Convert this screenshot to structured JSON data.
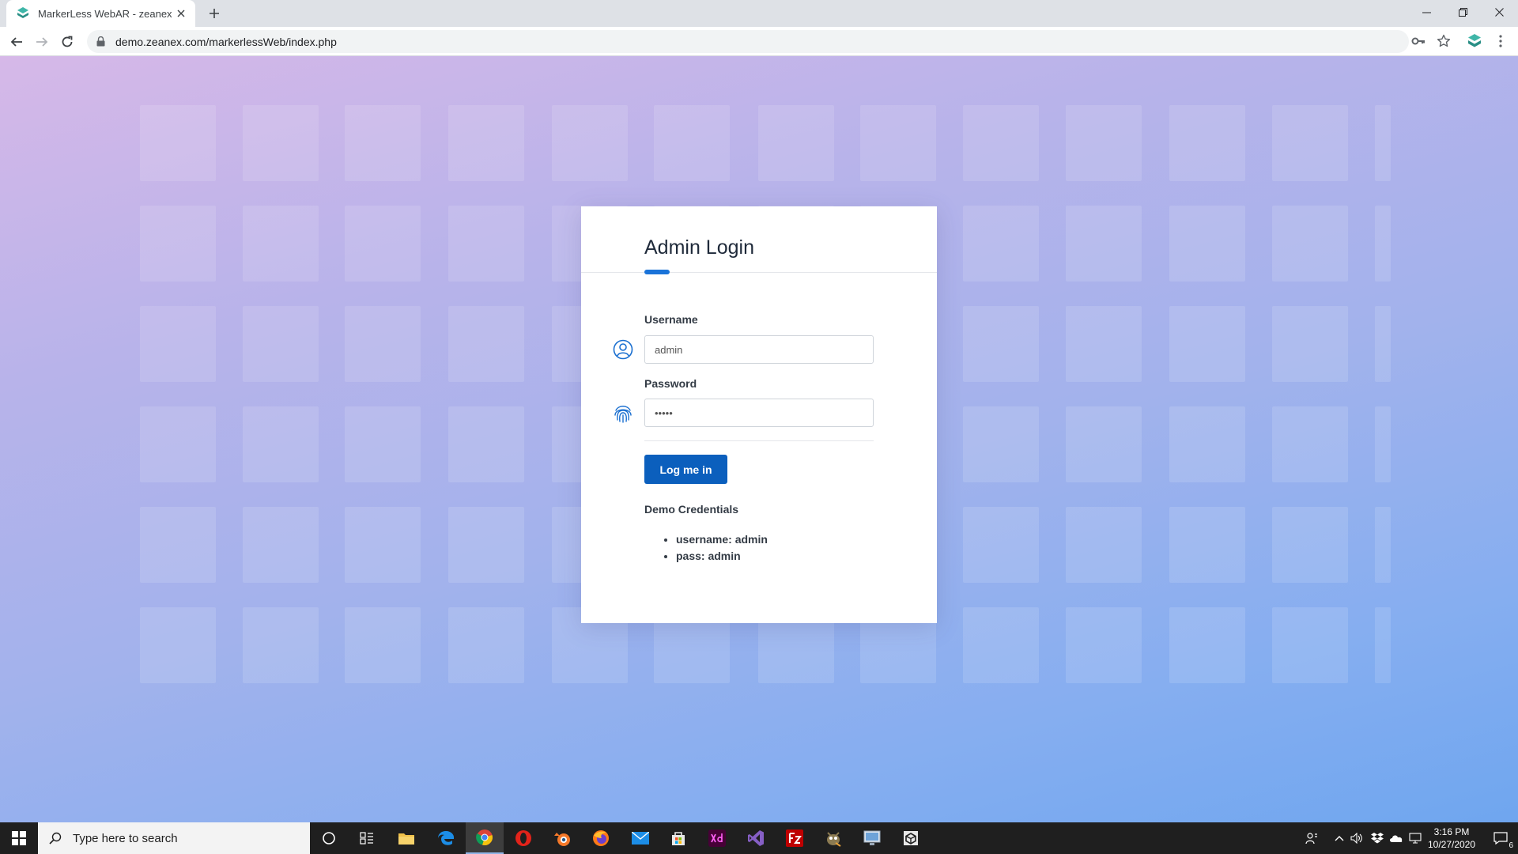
{
  "browser": {
    "tab_title": "MarkerLess WebAR - zeanex",
    "url": "demo.zeanex.com/markerlessWeb/index.php"
  },
  "login": {
    "title": "Admin Login",
    "username_label": "Username",
    "username_value": "admin",
    "password_label": "Password",
    "password_value": "admin",
    "button_label": "Log me in",
    "demo_title": "Demo Credentials",
    "demo_items": [
      "username: admin",
      "pass: admin"
    ]
  },
  "taskbar": {
    "search_placeholder": "Type here to search",
    "time": "3:16 PM",
    "date": "10/27/2020",
    "notification_count": "6"
  },
  "colors": {
    "accent": "#1a73d9",
    "button": "#0b5fbd"
  }
}
